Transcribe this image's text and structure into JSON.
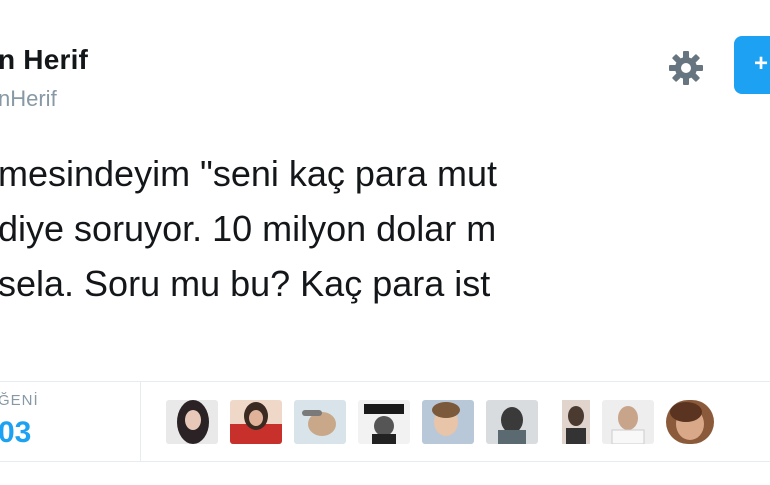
{
  "profile": {
    "name": "n Herif",
    "handle": "nHerif"
  },
  "header": {
    "settings_icon": "gear-icon",
    "follow_button_icon": "follow-icon"
  },
  "tweet": {
    "lines": [
      "mesindeyim \"seni kaç para mut",
      " diye soruyor. 10 milyon dolar m",
      "sela. Soru mu bu? Kaç para ist"
    ]
  },
  "stats": {
    "likes_label": "ĞENİ",
    "likes_count": "03"
  },
  "colors": {
    "accent": "#1da1f2",
    "secondary_text": "#8899a6",
    "divider": "#e6ecf0"
  },
  "likers": [
    {
      "name": "liker-avatar-1"
    },
    {
      "name": "liker-avatar-2"
    },
    {
      "name": "liker-avatar-3"
    },
    {
      "name": "liker-avatar-4"
    },
    {
      "name": "liker-avatar-5"
    },
    {
      "name": "liker-avatar-6"
    },
    {
      "name": "liker-avatar-7"
    },
    {
      "name": "liker-avatar-8"
    },
    {
      "name": "liker-avatar-9"
    }
  ]
}
